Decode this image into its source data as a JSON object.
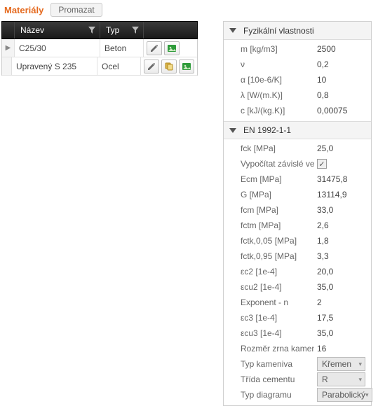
{
  "header": {
    "title": "Materiály",
    "promazat": "Promazat"
  },
  "table": {
    "col_name": "Název",
    "col_typ": "Typ",
    "rows": [
      {
        "name": "C25/30",
        "typ": "Beton",
        "selected": true,
        "extra": false
      },
      {
        "name": "Upravený S 235",
        "typ": "Ocel",
        "selected": false,
        "extra": true
      }
    ]
  },
  "props": {
    "group1_title": "Fyzikální vlastnosti",
    "group2_title": "EN 1992-1-1",
    "g1": [
      {
        "label": "m [kg/m3]",
        "value": "2500"
      },
      {
        "label": "ν",
        "value": "0,2"
      },
      {
        "label": "α [10e-6/K]",
        "value": "10"
      },
      {
        "label": "λ [W/(m.K)]",
        "value": "0,8"
      },
      {
        "label": "c [kJ/(kg.K)]",
        "value": "0,00075"
      }
    ],
    "g2": [
      {
        "label": "fck [MPa]",
        "value": "25,0"
      },
      {
        "label": "Vypočítat závislé veličiny",
        "value": null,
        "checkbox": true
      },
      {
        "label": "Ecm [MPa]",
        "value": "31475,8"
      },
      {
        "label": "G [MPa]",
        "value": "13114,9"
      },
      {
        "label": "fcm [MPa]",
        "value": "33,0"
      },
      {
        "label": "fctm [MPa]",
        "value": "2,6"
      },
      {
        "label": "fctk,0,05 [MPa]",
        "value": "1,8"
      },
      {
        "label": "fctk,0,95 [MPa]",
        "value": "3,3"
      },
      {
        "label": "εc2 [1e-4]",
        "value": "20,0"
      },
      {
        "label": "εcu2 [1e-4]",
        "value": "35,0"
      },
      {
        "label": "Exponent - n",
        "value": "2"
      },
      {
        "label": "εc3 [1e-4]",
        "value": "17,5"
      },
      {
        "label": "εcu3 [1e-4]",
        "value": "35,0"
      },
      {
        "label": "Rozměr zrna kameniva",
        "value": "16"
      },
      {
        "label": "Typ kameniva",
        "value": "Křemen",
        "combo": true
      },
      {
        "label": "Třída cementu",
        "value": "R",
        "combo": true
      },
      {
        "label": "Typ diagramu",
        "value": "Parabolický",
        "combo": true
      }
    ]
  }
}
